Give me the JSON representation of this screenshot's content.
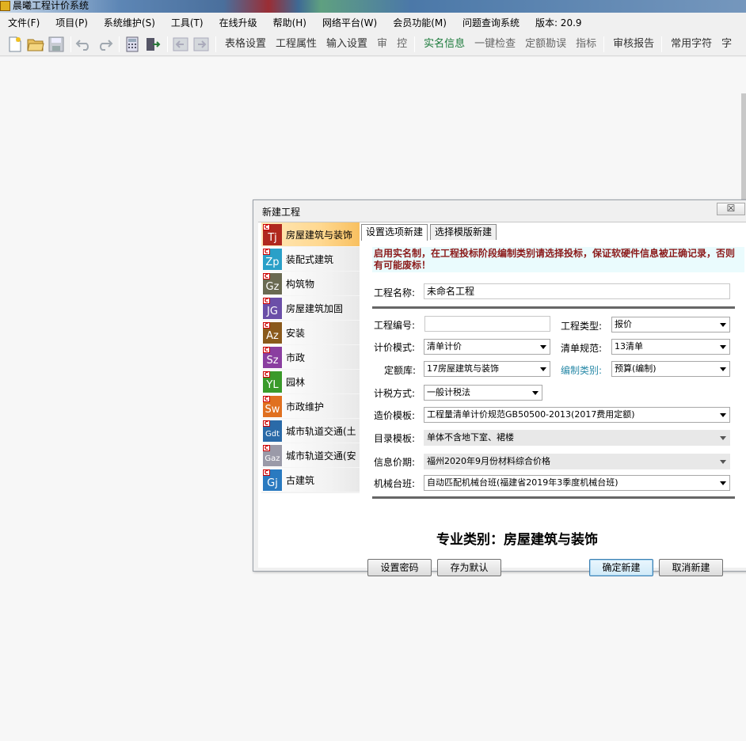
{
  "window": {
    "title": "晨曦工程计价系统"
  },
  "menubar": {
    "items": [
      "文件(F)",
      "项目(P)",
      "系统维护(S)",
      "工具(T)",
      "在线升级",
      "帮助(H)",
      "网络平台(W)",
      "会员功能(M)",
      "问题查询系统",
      "版本: 20.9"
    ]
  },
  "toolbar": {
    "text_items": [
      "表格设置",
      "工程属性",
      "输入设置",
      "审",
      "控",
      "实名信息",
      "一键检查",
      "定额勘误",
      "指标",
      "审核报告",
      "常用字符",
      "字"
    ]
  },
  "dialog": {
    "title": "新建工程",
    "close_label": "☒",
    "categories": [
      {
        "code": "Tj",
        "label": "房屋建筑与装饰",
        "color": "#b0281e"
      },
      {
        "code": "Zp",
        "label": "装配式建筑",
        "color": "#2aa0c8"
      },
      {
        "code": "Gz",
        "label": "构筑物",
        "color": "#6a6a52"
      },
      {
        "code": "JG",
        "label": "房屋建筑加固",
        "color": "#6b4fa8"
      },
      {
        "code": "Az",
        "label": "安装",
        "color": "#8a5a1c"
      },
      {
        "code": "Sz",
        "label": "市政",
        "color": "#8a3ea0"
      },
      {
        "code": "YL",
        "label": "园林",
        "color": "#3a9a2a"
      },
      {
        "code": "Sw",
        "label": "市政维护",
        "color": "#e07020"
      },
      {
        "code": "Gdt",
        "label": "城市轨道交通(土",
        "color": "#2a6aa8"
      },
      {
        "code": "Gaz",
        "label": "城市轨道交通(安",
        "color": "#9a9aa8"
      },
      {
        "code": "Gj",
        "label": "古建筑",
        "color": "#2a7ac0"
      }
    ],
    "tabs": [
      "设置选项新建",
      "选择模版新建"
    ],
    "notice": "启用实名制，在工程投标阶段编制类别请选择投标，保证软硬件信息被正确记录，否则有可能废标！",
    "fields": {
      "project_name_label": "工程名称:",
      "project_name_value": "未命名工程",
      "project_code_label": "工程编号:",
      "project_code_value": "",
      "project_type_label": "工程类型:",
      "project_type_value": "报价",
      "pricing_mode_label": "计价模式:",
      "pricing_mode_value": "清单计价",
      "spec_label": "清单规范:",
      "spec_value": "13清单",
      "quota_label": "定额库:",
      "quota_value": "17房屋建筑与装饰",
      "compile_label": "编制类别:",
      "compile_value": "预算(编制)",
      "tax_label": "计税方式:",
      "tax_value": "一般计税法",
      "cost_template_label": "造价模板:",
      "cost_template_value": "工程量清单计价规范GB50500-2013(2017费用定额)",
      "catalog_label": "目录模板:",
      "catalog_value": "单体不含地下室、裙楼",
      "price_label": "信息价期:",
      "price_value": "福州2020年9月份材料综合价格",
      "machine_label": "机械台班:",
      "machine_value": "自动匹配机械台班(福建省2019年3季度机械台班)"
    },
    "specialty": "专业类别：房屋建筑与装饰",
    "buttons": {
      "set_password": "设置密码",
      "save_default": "存为默认",
      "confirm": "确定新建",
      "cancel": "取消新建"
    }
  }
}
